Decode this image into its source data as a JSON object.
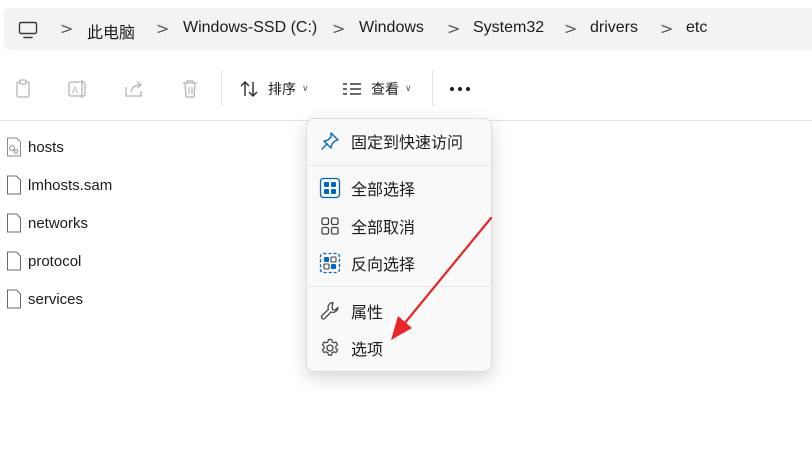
{
  "address_bar": {
    "icon": "this-pc-icon",
    "separator": ">",
    "crumbs": [
      "此电脑",
      "Windows-SSD (C:)",
      "Windows",
      "System32",
      "drivers",
      "etc"
    ]
  },
  "command_bar": {
    "icons": [
      "copy-icon",
      "rename-icon",
      "share-icon",
      "delete-icon"
    ],
    "sort_label": "排序",
    "view_label": "查看",
    "more_icon": "more-options-icon"
  },
  "files": [
    {
      "name": "hosts",
      "icon": "system-file-icon"
    },
    {
      "name": "lmhosts.sam",
      "icon": "file-icon"
    },
    {
      "name": "networks",
      "icon": "file-icon"
    },
    {
      "name": "protocol",
      "icon": "file-icon"
    },
    {
      "name": "services",
      "icon": "file-icon"
    }
  ],
  "context_menu": {
    "items": [
      {
        "label": "固定到快速访问",
        "icon": "pin-icon"
      },
      {
        "label": "全部选择",
        "icon": "select-all-icon"
      },
      {
        "label": "全部取消",
        "icon": "select-none-icon"
      },
      {
        "label": "反向选择",
        "icon": "invert-selection-icon"
      },
      {
        "label": "属性",
        "icon": "wrench-icon"
      },
      {
        "label": "选项",
        "icon": "gear-icon"
      }
    ]
  },
  "colors": {
    "accent": "#0067c0",
    "annotation_arrow": "#e8262a"
  }
}
